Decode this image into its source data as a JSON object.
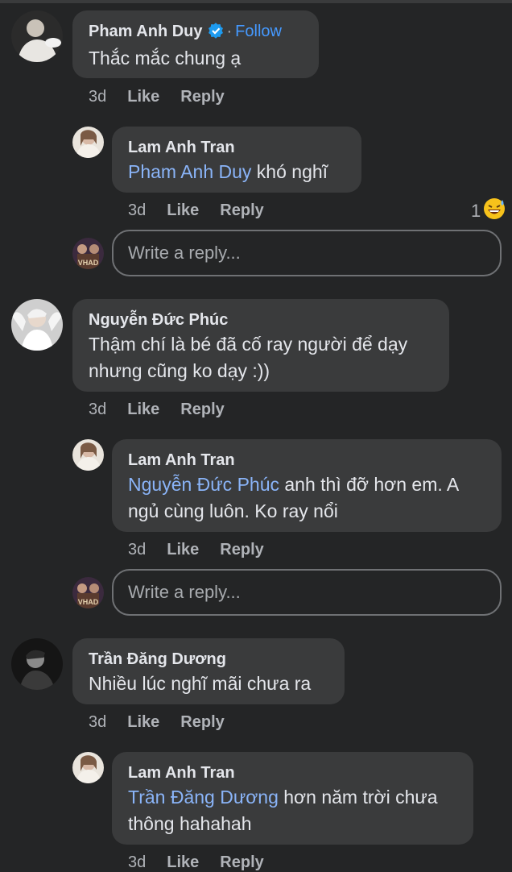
{
  "comments": [
    {
      "author": "Pham Anh Duy",
      "verified": true,
      "separator": "·",
      "follow_label": "Follow",
      "text": "Thắc mắc chung ạ",
      "time": "3d",
      "like_label": "Like",
      "reply_label": "Reply",
      "reply": {
        "author": "Lam Anh Tran",
        "mention": "Pham Anh Duy",
        "text": " khó nghĩ",
        "time": "3d",
        "like_label": "Like",
        "reply_label": "Reply",
        "reaction_count": "1",
        "reaction_icon": "grinning-sweat-emoji"
      },
      "reply_input_placeholder": "Write a reply..."
    },
    {
      "author": "Nguyễn Đức Phúc",
      "text": "Thậm chí là bé đã cố ray người để dạy nhưng cũng ko dạy :))",
      "time": "3d",
      "like_label": "Like",
      "reply_label": "Reply",
      "reply": {
        "author": "Lam Anh Tran",
        "mention": "Nguyễn Đức Phúc",
        "text": " anh thì đỡ hơn em. A ngủ cùng luôn. Ko ray nổi",
        "time": "3d",
        "like_label": "Like",
        "reply_label": "Reply"
      },
      "reply_input_placeholder": "Write a reply..."
    },
    {
      "author": "Trần Đăng Dương",
      "text": "Nhiều lúc nghĩ mãi chưa ra",
      "time": "3d",
      "like_label": "Like",
      "reply_label": "Reply",
      "reply": {
        "author": "Lam Anh Tran",
        "mention": "Trần Đăng Dương",
        "text": " hơn năm trời chưa thông hahahah",
        "time": "3d",
        "like_label": "Like",
        "reply_label": "Reply"
      }
    }
  ],
  "colors": {
    "background": "#242526",
    "bubble": "#3a3b3c",
    "mention": "#8ab4f8",
    "follow": "#4599ff",
    "meta": "#b0b3b8"
  }
}
